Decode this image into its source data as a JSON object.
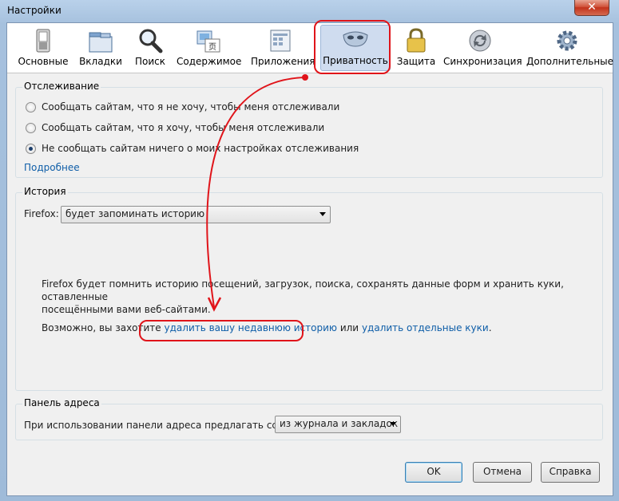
{
  "window": {
    "title": "Настройки",
    "close_glyph": "✕"
  },
  "toolbar": {
    "items": [
      {
        "label": "Основные",
        "icon": "switch-icon"
      },
      {
        "label": "Вкладки",
        "icon": "tabs-icon"
      },
      {
        "label": "Поиск",
        "icon": "magnifier-icon"
      },
      {
        "label": "Содержимое",
        "icon": "content-icon"
      },
      {
        "label": "Приложения",
        "icon": "applications-icon"
      },
      {
        "label": "Приватность",
        "icon": "mask-icon"
      },
      {
        "label": "Защита",
        "icon": "lock-icon"
      },
      {
        "label": "Синхронизация",
        "icon": "sync-icon"
      },
      {
        "label": "Дополнительные",
        "icon": "gear-icon"
      }
    ],
    "selected": "Приватность"
  },
  "tracking": {
    "caption": "Отслеживание",
    "options": [
      {
        "label": "Сообщать сайтам, что я не хочу, чтобы меня отслеживали",
        "selected": false
      },
      {
        "label": "Сообщать сайтам, что я хочу, чтобы меня отслеживали",
        "selected": false
      },
      {
        "label": "Не сообщать сайтам ничего о моих настройках отслеживания",
        "selected": true
      }
    ],
    "more_link": "Подробнее"
  },
  "history": {
    "caption": "История",
    "firefox_label": "Firefox:",
    "mode_value": "будет запоминать историю",
    "description_line1": "Firefox будет помнить историю посещений, загрузок, поиска, сохранять данные форм и хранить куки, оставленные",
    "description_line2": "посещёнными вами веб-сайтами.",
    "hint_prefix": "Возможно, вы захотите",
    "link_clear_recent": "удалить вашу недавнюю историю",
    "hint_or": "или",
    "link_remove_cookies": "удалить отдельные куки",
    "hint_suffix": "."
  },
  "address_bar": {
    "caption": "Панель адреса",
    "label": "При использовании панели адреса предлагать ссылки:",
    "suggest_value": "из журнала и закладок"
  },
  "buttons": {
    "ok": "OK",
    "cancel": "Отмена",
    "help": "Справка"
  },
  "colors": {
    "annotation_red": "#e0141a",
    "link_blue": "#0f5ea8",
    "selected_tab_bg": "#cfdcef"
  }
}
